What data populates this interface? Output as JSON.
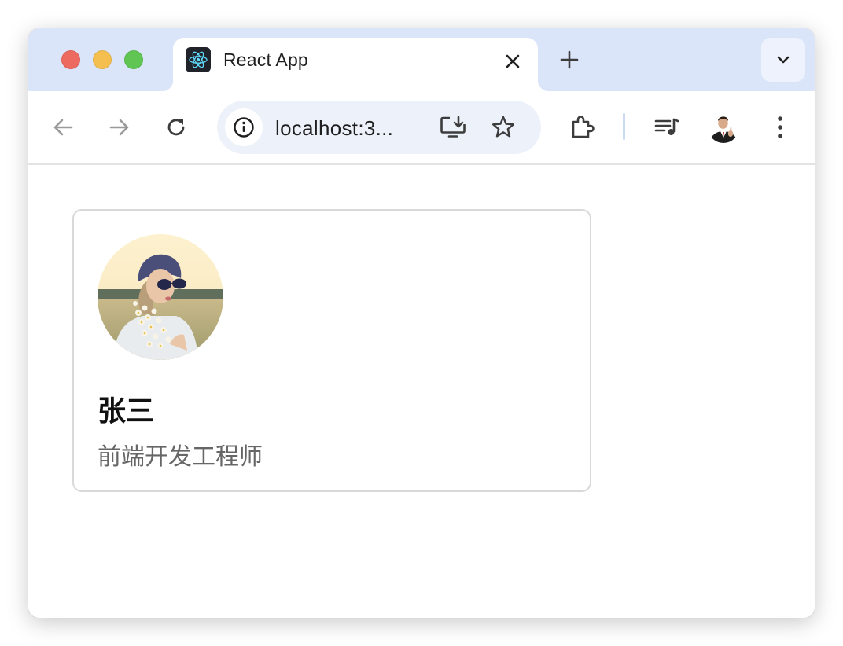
{
  "window": {
    "controls": [
      "close",
      "minimize",
      "zoom"
    ]
  },
  "tab": {
    "title": "React App",
    "favicon": "react-icon"
  },
  "toolbar": {
    "address": "localhost:3...",
    "icons": [
      "back-arrow-icon",
      "forward-arrow-icon",
      "reload-icon",
      "site-info-icon",
      "install-app-icon",
      "bookmark-star-icon",
      "extensions-puzzle-icon",
      "media-playlist-icon",
      "profile-avatar",
      "more-menu-icon"
    ]
  },
  "profile_card": {
    "name": "张三",
    "role": "前端开发工程师"
  },
  "colors": {
    "tabstrip_bg": "#dbe5fa",
    "omnibox_bg": "#edf2fa",
    "card_border": "#d9d9d9",
    "role_text": "#666666"
  }
}
